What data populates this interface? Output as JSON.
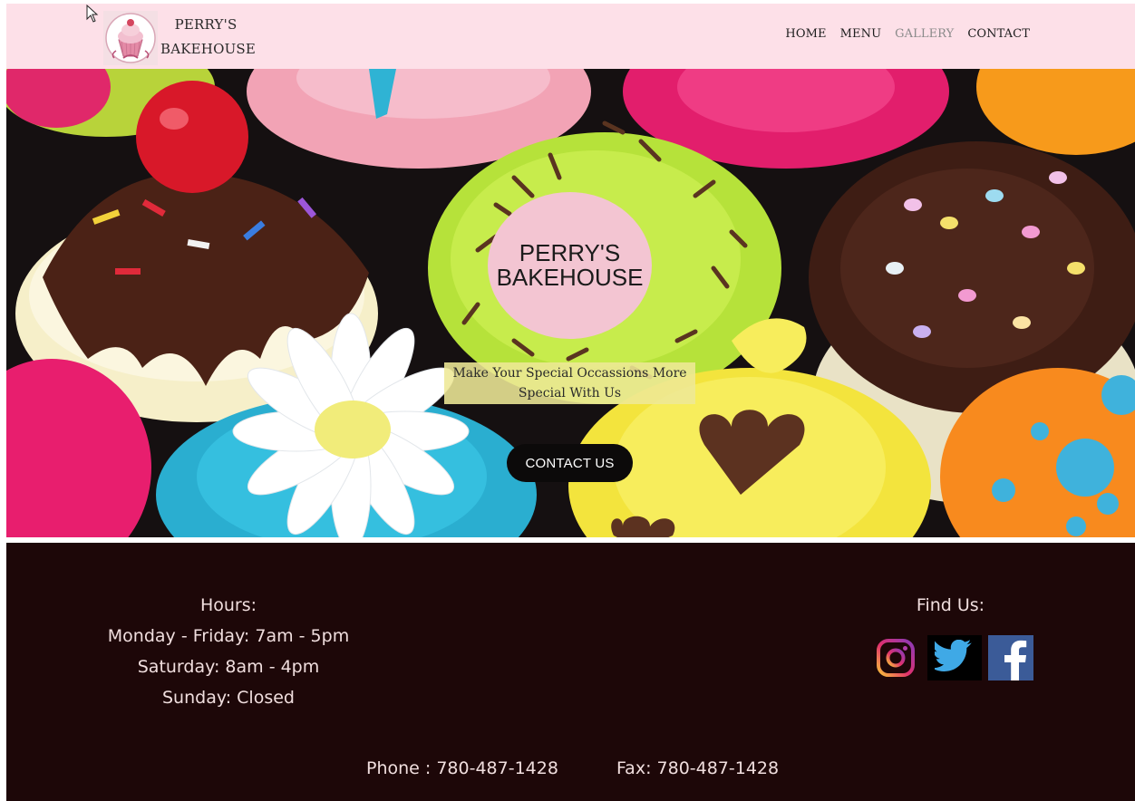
{
  "header": {
    "brand_line1": "PERRY'S",
    "brand_line2": "BAKEHOUSE",
    "logo_icon": "cupcake-logo-icon",
    "nav": [
      {
        "label": "HOME",
        "active": false
      },
      {
        "label": "MENU",
        "active": false
      },
      {
        "label": "GALLERY",
        "active": true
      },
      {
        "label": "CONTACT",
        "active": false
      }
    ]
  },
  "hero": {
    "title_line1": "PERRY'S",
    "title_line2": "BAKEHOUSE",
    "tagline_line1": "Make Your Special Occassions More",
    "tagline_line2": "Special With Us",
    "cta_label": "CONTACT US"
  },
  "footer": {
    "hours_title": "Hours:",
    "hours": [
      "Monday - Friday: 7am - 5pm",
      "Saturday: 8am - 4pm",
      "Sunday: Closed"
    ],
    "find_us_title": "Find Us:",
    "socials": [
      {
        "icon": "instagram-icon"
      },
      {
        "icon": "twitter-icon"
      },
      {
        "icon": "facebook-icon"
      }
    ],
    "phone": "Phone : 780-487-1428",
    "fax": "Fax: 780-487-1428"
  },
  "colors": {
    "nav_bg": "#fde0e8",
    "footer_bg": "#1d0708",
    "title_circle": "#f3c5d2",
    "tagline_bg": "#eee896",
    "button_bg": "#0c0a0a"
  }
}
